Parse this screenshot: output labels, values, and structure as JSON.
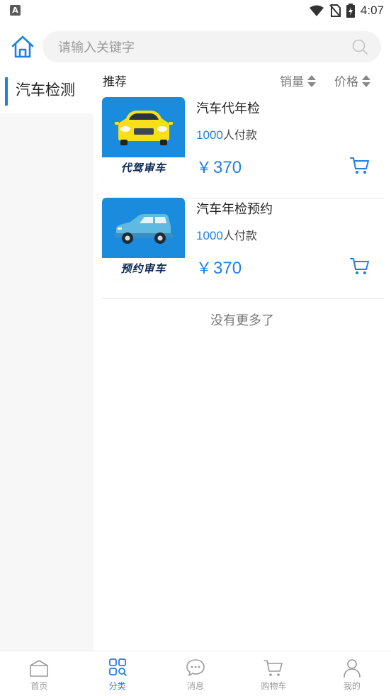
{
  "status_bar": {
    "app_icon": "A",
    "time": "4:07"
  },
  "search": {
    "placeholder": "请输入关键字"
  },
  "sidebar": {
    "items": [
      {
        "label": "汽车检测",
        "active": true
      }
    ]
  },
  "sort_bar": {
    "title": "推荐",
    "options": [
      {
        "label": "销量"
      },
      {
        "label": "价格"
      }
    ]
  },
  "products": [
    {
      "title": "汽车代年检",
      "sales_count": "1000",
      "sales_suffix": "人付款",
      "currency": "￥",
      "price": "370",
      "image_caption": "代驾审车"
    },
    {
      "title": "汽车年检预约",
      "sales_count": "1000",
      "sales_suffix": "人付款",
      "currency": "￥",
      "price": "370",
      "image_caption": "预约审车"
    }
  ],
  "list_end_text": "没有更多了",
  "bottom_nav": {
    "items": [
      {
        "label": "首页",
        "icon": "home-icon"
      },
      {
        "label": "分类",
        "icon": "category-icon",
        "active": true
      },
      {
        "label": "消息",
        "icon": "message-icon"
      },
      {
        "label": "购物车",
        "icon": "cart-icon"
      },
      {
        "label": "我的",
        "icon": "user-icon"
      }
    ]
  },
  "colors": {
    "accent": "#1e7fe6",
    "sidebar_bg": "#f7f7f7",
    "search_bg": "#f3f3f3",
    "thumb_bg": "#1b8bde"
  }
}
